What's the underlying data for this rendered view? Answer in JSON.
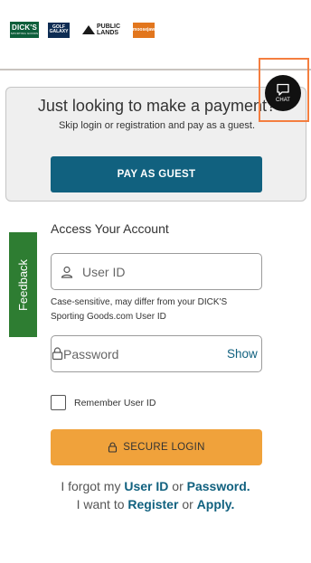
{
  "header": {
    "logos": [
      {
        "name": "DICK'S",
        "sub": "SPORTING GOODS"
      },
      {
        "name": "GOLF",
        "sub": "GALAXY"
      },
      {
        "name": "PUBLIC",
        "sub": "LANDS"
      },
      {
        "name": "moosejaw"
      }
    ]
  },
  "guest": {
    "title": "Just looking to make a payment?",
    "subtitle": "Skip login or registration and pay as a guest.",
    "button_label": "PAY AS GUEST"
  },
  "chat": {
    "label": "CHAT",
    "icon": "chat-bubble-icon"
  },
  "feedback": {
    "label": "Feedback"
  },
  "account": {
    "title": "Access Your Account",
    "user_id_placeholder": "User ID",
    "user_id_hint": "Case-sensitive, may differ from your DICK'S Sporting Goods.com User ID",
    "password_placeholder": "Password",
    "show_label": "Show",
    "remember_label": "Remember User ID",
    "login_label": "SECURE LOGIN"
  },
  "links": {
    "forgot_prefix": "I forgot my",
    "user_id": "User ID",
    "or1": "or",
    "password": "Password.",
    "want_prefix": "I want to",
    "register": "Register",
    "or2": "or",
    "apply": "Apply."
  },
  "colors": {
    "primary_button": "#11617f",
    "login_button": "#f0a23b",
    "feedback_tab": "#2e7d32",
    "chat_highlight": "#f47e3f"
  }
}
